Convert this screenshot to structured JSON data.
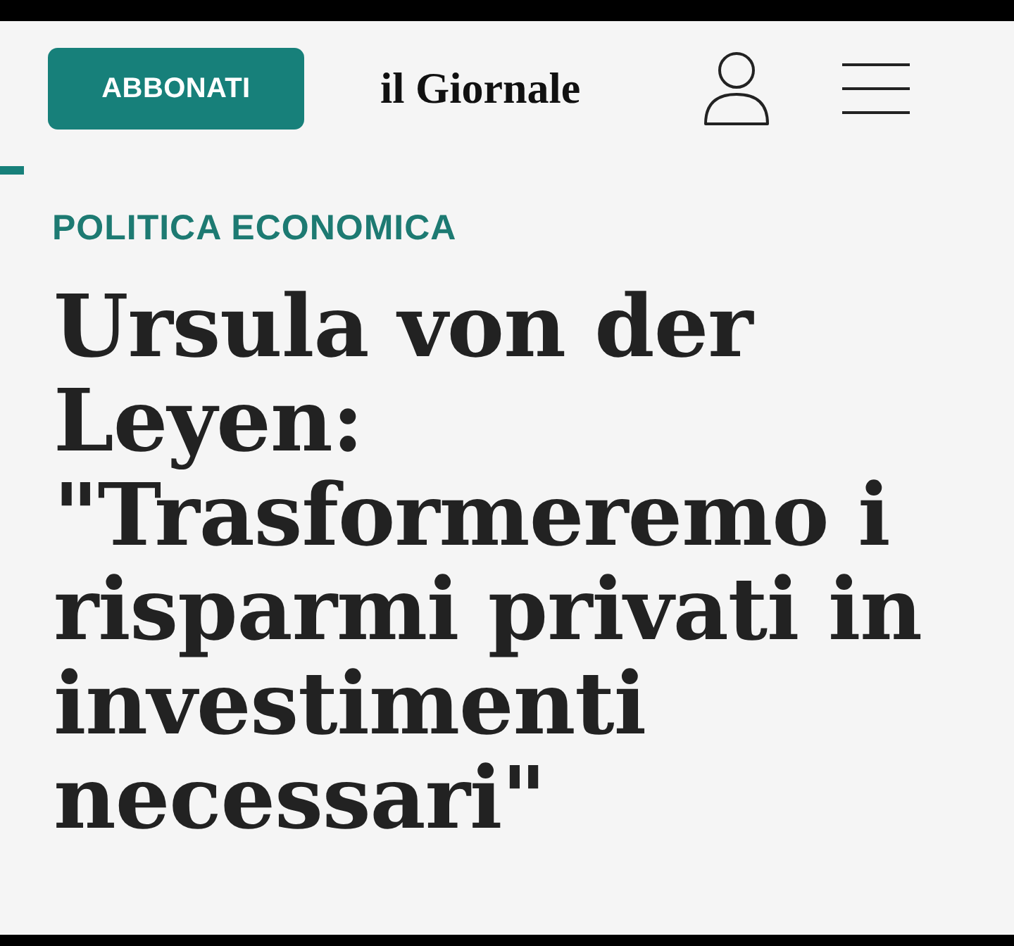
{
  "header": {
    "subscribe_button": "ABBONATI",
    "logo": "il Giornale"
  },
  "article": {
    "category": "POLITICA ECONOMICA",
    "headline": "Ursula von der Leyen: \"Trasformeremo i risparmi privati in investimenti necessari\""
  }
}
